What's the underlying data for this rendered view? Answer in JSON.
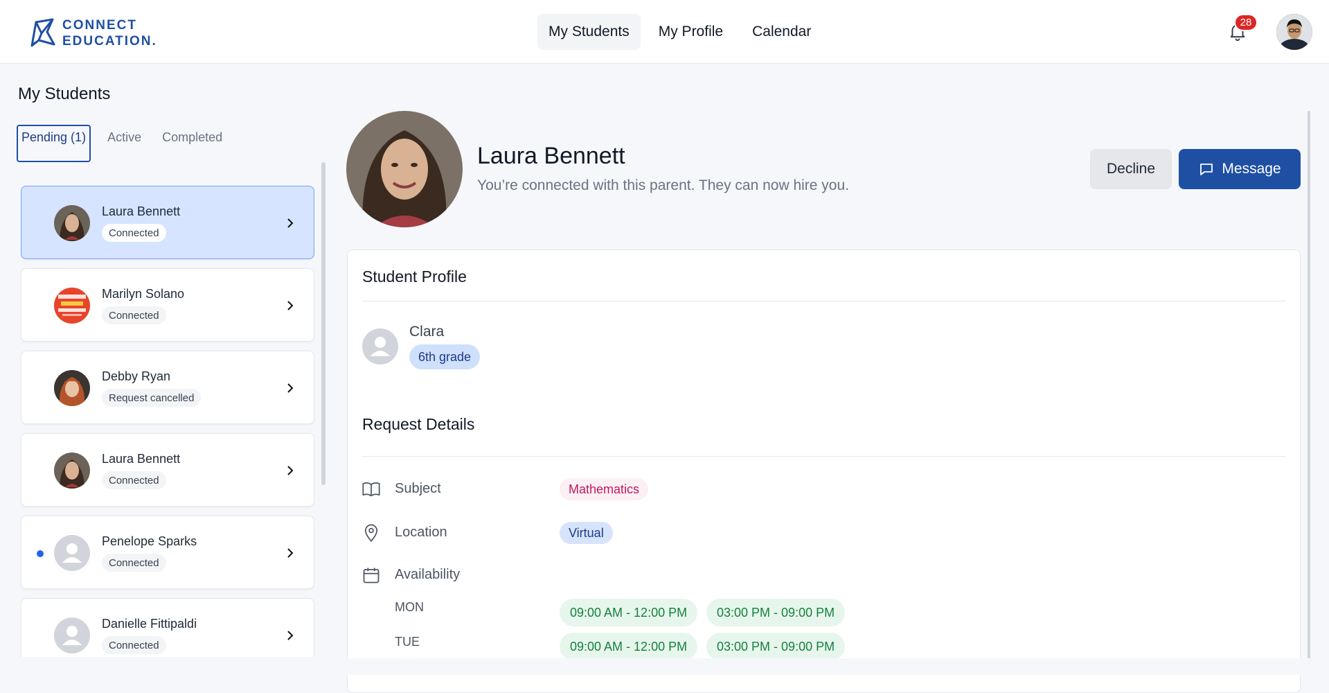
{
  "header": {
    "logo_line1": "CONNECT",
    "logo_line2": "EDUCATION.",
    "nav": [
      {
        "label": "My Students",
        "active": true
      },
      {
        "label": "My Profile",
        "active": false
      },
      {
        "label": "Calendar",
        "active": false
      }
    ],
    "notification_count": "28",
    "icons": {
      "bell": "bell-icon",
      "avatar": "user-avatar"
    }
  },
  "sidebar": {
    "title": "My Students",
    "tabs": [
      {
        "label": "Pending (1)",
        "active": true
      },
      {
        "label": "Active",
        "active": false
      },
      {
        "label": "Completed",
        "active": false
      }
    ],
    "students": [
      {
        "name": "Laura Bennett",
        "status": "Connected",
        "selected": true,
        "unread": false,
        "avatar": "photo-woman"
      },
      {
        "name": "Marilyn Solano",
        "status": "Connected",
        "selected": false,
        "unread": false,
        "avatar": "poster"
      },
      {
        "name": "Debby Ryan",
        "status": "Request cancelled",
        "selected": false,
        "unread": false,
        "avatar": "photo-redhead"
      },
      {
        "name": "Laura Bennett",
        "status": "Connected",
        "selected": false,
        "unread": false,
        "avatar": "photo-woman"
      },
      {
        "name": "Penelope Sparks",
        "status": "Connected",
        "selected": false,
        "unread": true,
        "avatar": "placeholder"
      },
      {
        "name": "Danielle Fittipaldi",
        "status": "Connected",
        "selected": false,
        "unread": false,
        "avatar": "placeholder"
      }
    ]
  },
  "detail": {
    "name": "Laura Bennett",
    "subtitle": "You’re connected with this parent. They can now hire you.",
    "decline_label": "Decline",
    "message_label": "Message",
    "student_profile_title": "Student Profile",
    "student": {
      "name": "Clara",
      "grade": "6th grade"
    },
    "request_details_title": "Request Details",
    "subject_label": "Subject",
    "subject_value": "Mathematics",
    "location_label": "Location",
    "location_value": "Virtual",
    "availability_label": "Availability",
    "availability": [
      {
        "day": "MON",
        "slots": [
          "09:00 AM - 12:00 PM",
          "03:00 PM - 09:00 PM"
        ]
      },
      {
        "day": "TUE",
        "slots": [
          "09:00 AM - 12:00 PM",
          "03:00 PM - 09:00 PM"
        ]
      }
    ]
  },
  "colors": {
    "brand": "#1e4fa3",
    "selected_card": "#d6e4ff",
    "badge": "#dc2626",
    "subject_text": "#be185d",
    "slot_text": "#15803d"
  }
}
